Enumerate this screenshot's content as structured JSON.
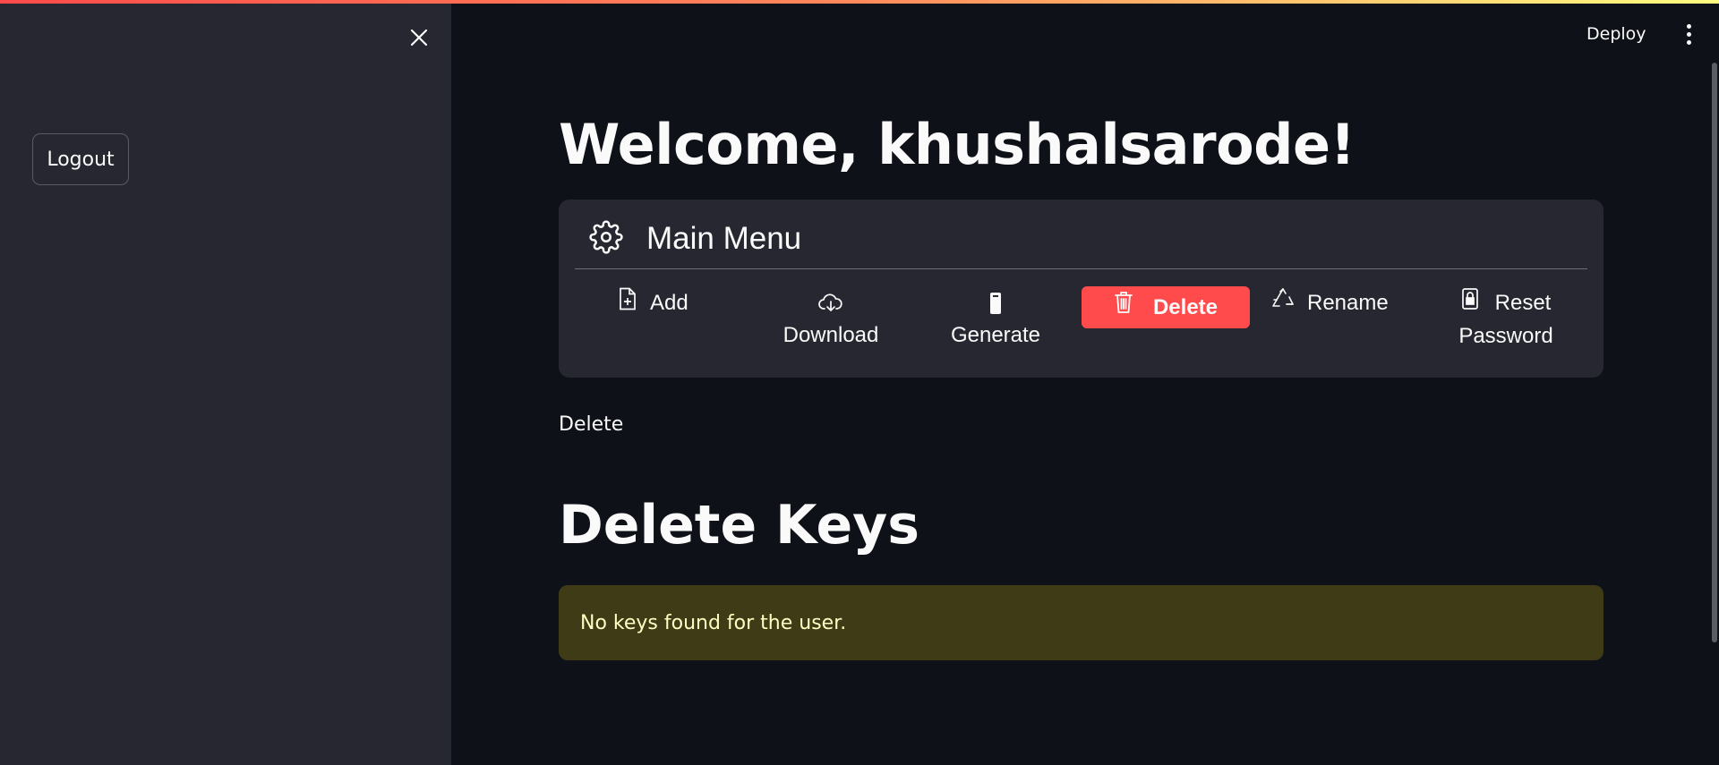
{
  "sidebar": {
    "close_icon": "close-icon",
    "logout_label": "Logout"
  },
  "header": {
    "deploy_label": "Deploy",
    "menu_icon": "kebab-icon"
  },
  "main": {
    "welcome_title": "Welcome, khushalsarode!",
    "menu": {
      "title": "Main Menu",
      "icon": "gear-icon",
      "items": [
        {
          "label": "Add",
          "icon": "file-plus-icon"
        },
        {
          "label": "Download",
          "icon": "cloud-download-icon"
        },
        {
          "label": "Generate",
          "icon": "device-icon"
        },
        {
          "label": "Delete",
          "icon": "trash-icon",
          "selected": true
        },
        {
          "label": "Rename",
          "icon": "recycle-icon"
        },
        {
          "label": "Reset Password",
          "icon": "lock-icon"
        }
      ]
    },
    "selected_echo": "Delete",
    "section_title": "Delete Keys",
    "warning_message": "No keys found for the user."
  },
  "colors": {
    "accent": "#ff4b4b",
    "background": "#0e1117",
    "sidebar_bg": "#262730",
    "warning_bg": "#3e3b16",
    "warning_text": "#ffffc2"
  }
}
